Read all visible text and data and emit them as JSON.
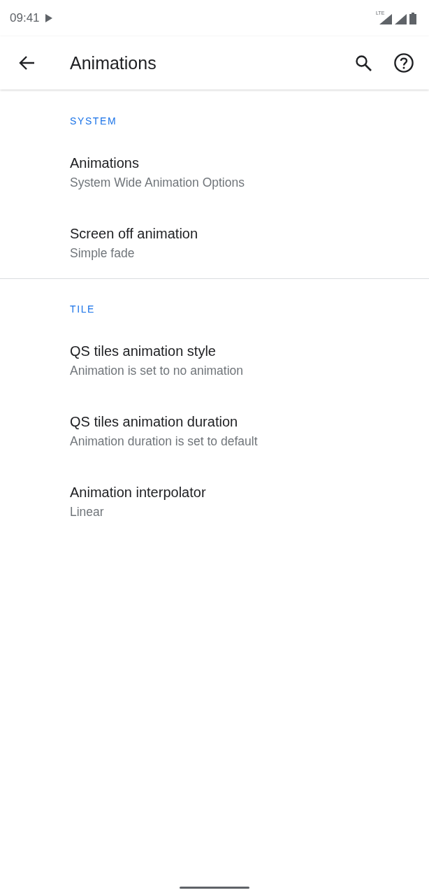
{
  "status_bar": {
    "time": "09:41",
    "network_label": "LTE"
  },
  "toolbar": {
    "title": "Animations"
  },
  "sections": [
    {
      "header": "SYSTEM",
      "items": [
        {
          "title": "Animations",
          "summary": "System Wide Animation Options"
        },
        {
          "title": "Screen off animation",
          "summary": "Simple fade"
        }
      ]
    },
    {
      "header": "TILE",
      "items": [
        {
          "title": "QS tiles animation style",
          "summary": "Animation is set to no animation"
        },
        {
          "title": "QS tiles animation duration",
          "summary": "Animation duration is set to default"
        },
        {
          "title": "Animation interpolator",
          "summary": "Linear"
        }
      ]
    }
  ]
}
